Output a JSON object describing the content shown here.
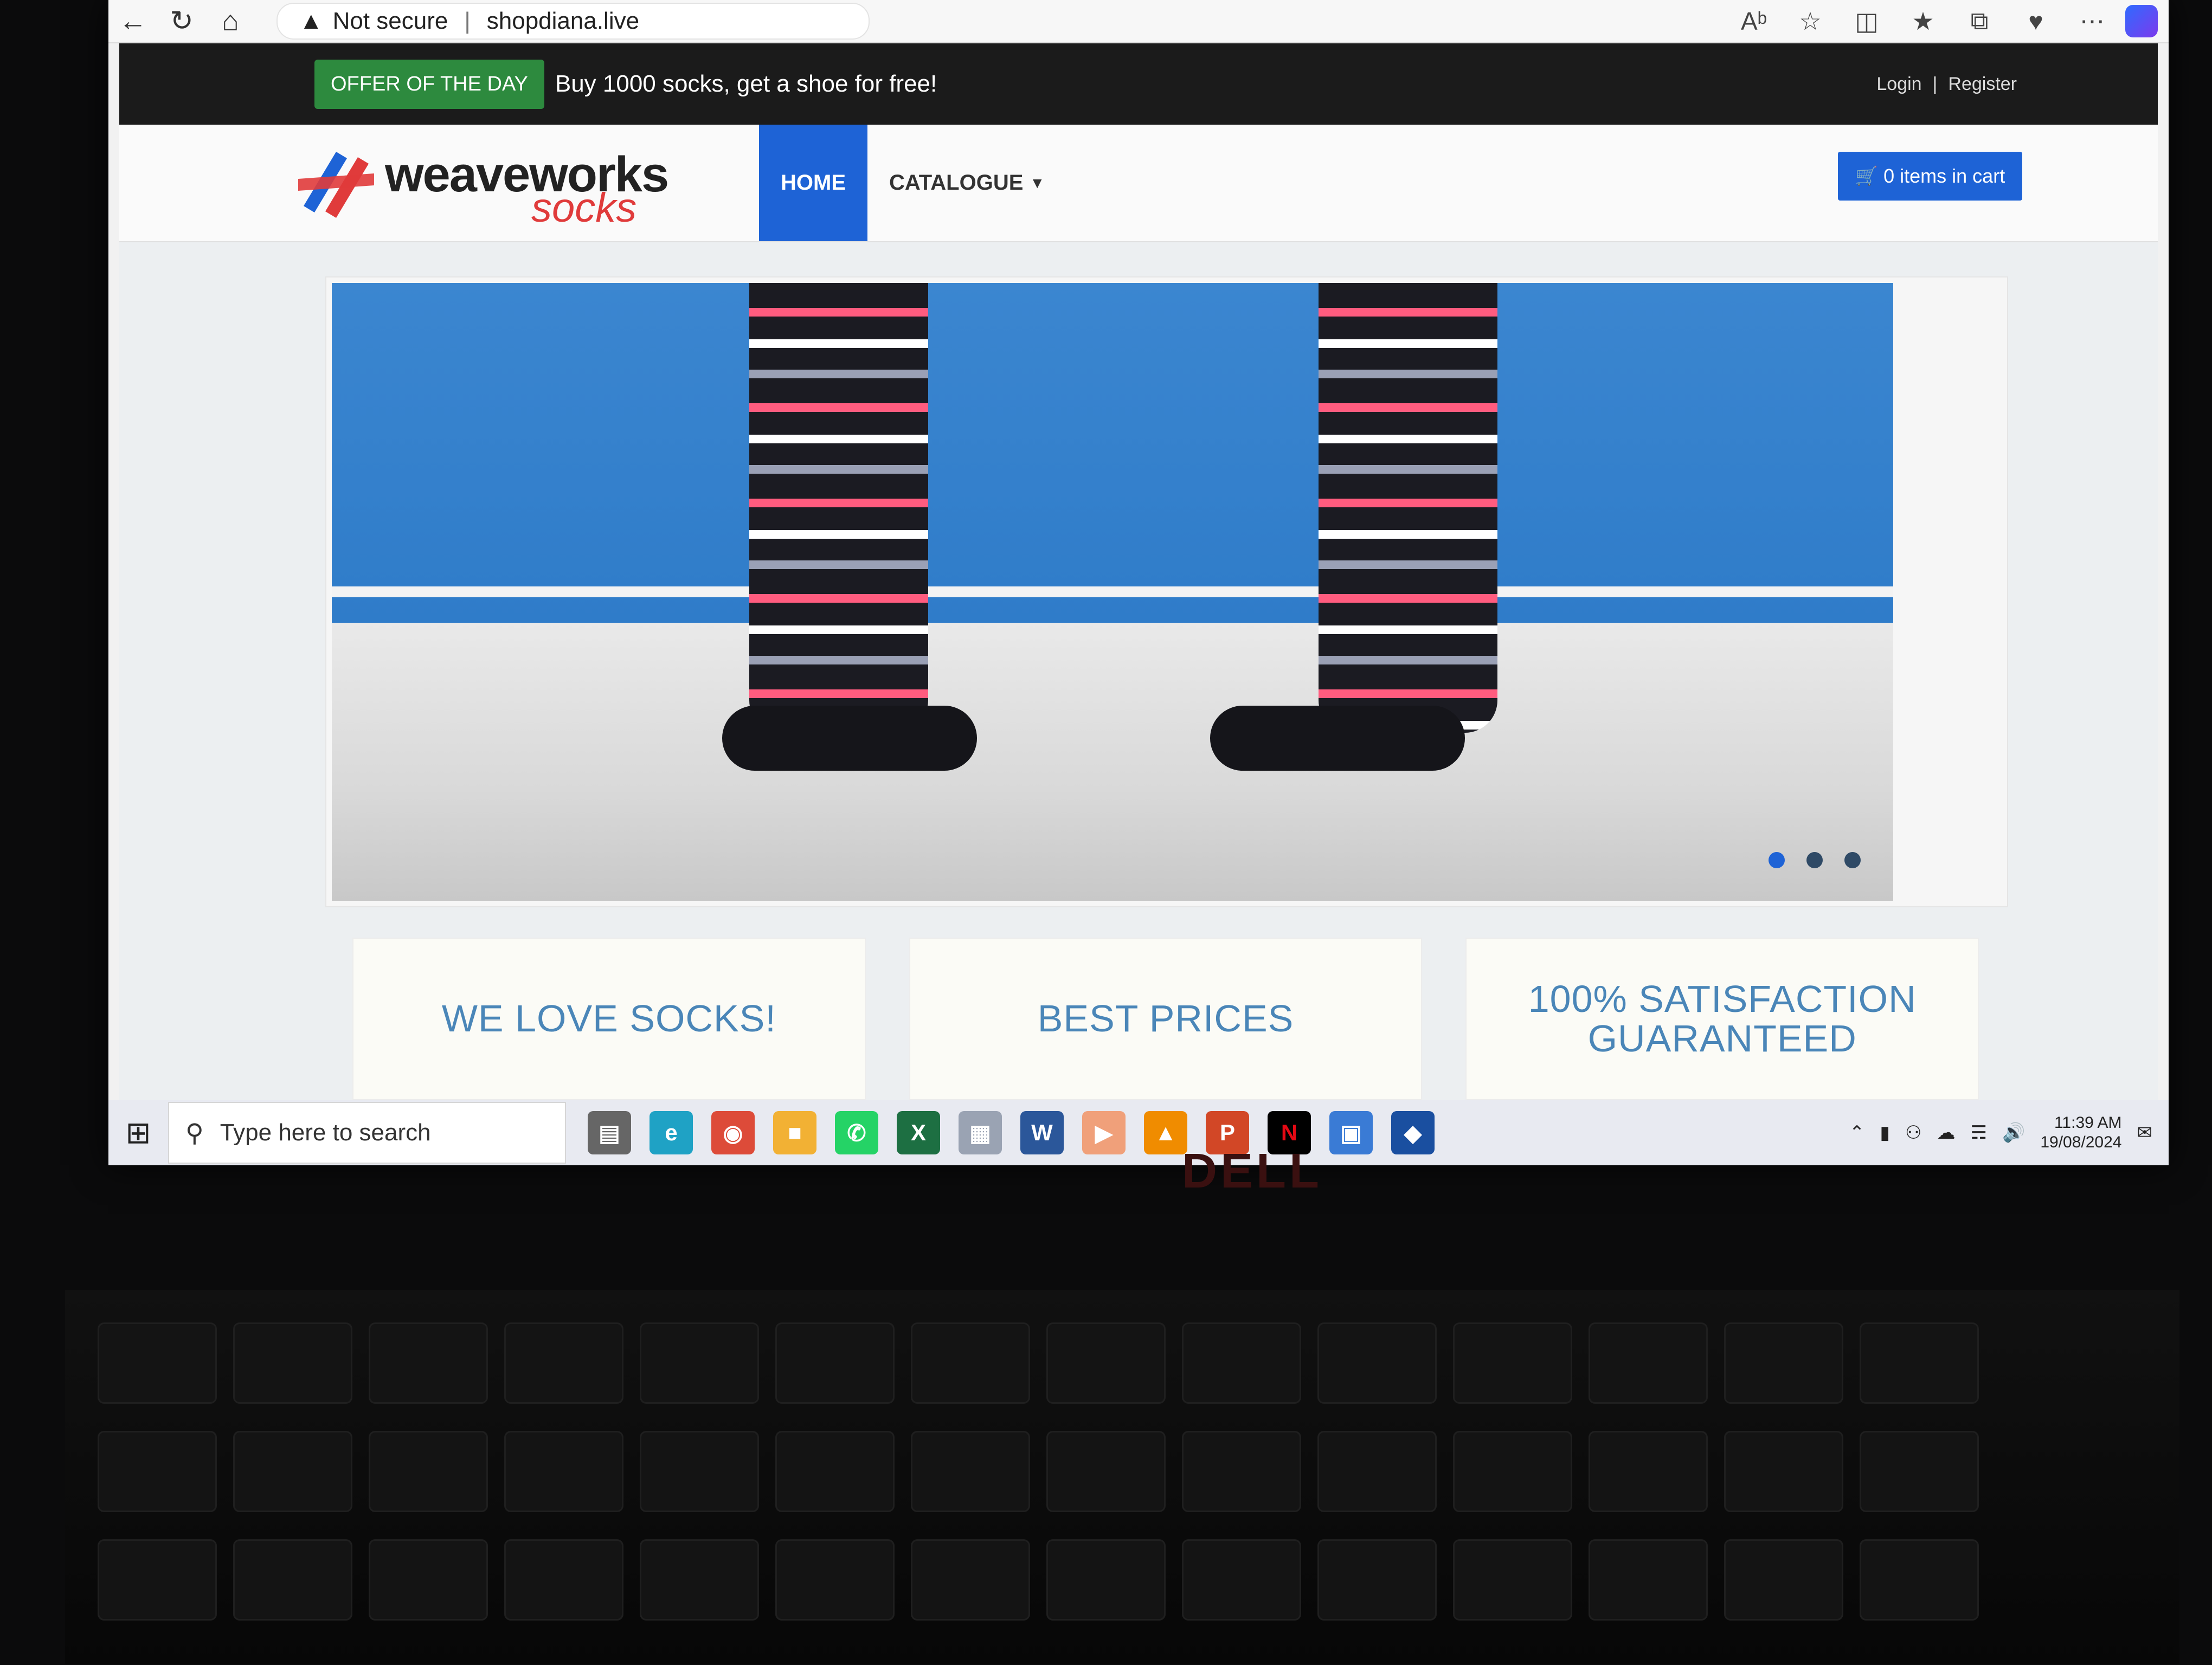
{
  "browser": {
    "security_label": "Not secure",
    "url": "shopdiana.live"
  },
  "site": {
    "offer": {
      "badge": "OFFER OF THE DAY",
      "text": "Buy 1000 socks, get a shoe for free!"
    },
    "auth": {
      "login": "Login",
      "register": "Register"
    },
    "logo": {
      "word": "weaveworks",
      "sub": "socks"
    },
    "nav": {
      "home": "HOME",
      "catalogue": "CATALOGUE"
    },
    "cart": {
      "label": "0 items in cart"
    },
    "carousel": {
      "dots": 3,
      "active_index": 0
    },
    "features": [
      {
        "label": "WE LOVE SOCKS!"
      },
      {
        "label": "BEST PRICES"
      },
      {
        "label": "100% SATISFACTION GUARANTEED"
      }
    ]
  },
  "taskbar": {
    "search_placeholder": "Type here to search",
    "time": "11:39 AM",
    "date": "19/08/2024"
  },
  "colors": {
    "accent_blue": "#1e63d6",
    "offer_green": "#2d8a3e",
    "feature_text": "#4a86b8",
    "topbar": "#1b1b1b"
  },
  "bezel": {
    "brand": "DELL"
  }
}
